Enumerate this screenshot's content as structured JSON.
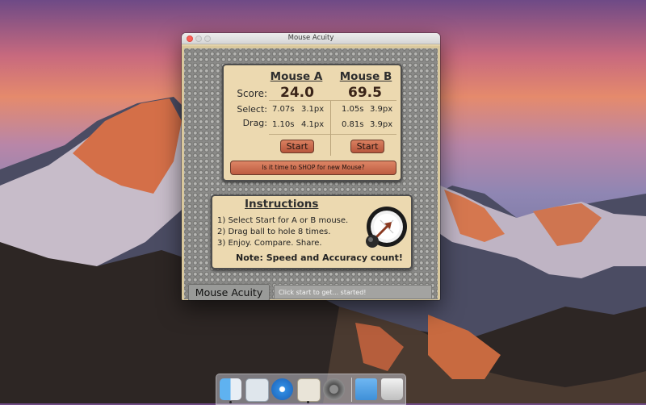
{
  "window": {
    "title": "Mouse Acuity"
  },
  "score_panel": {
    "mouse_a": {
      "title": "Mouse A",
      "score": "24.0",
      "select_time": "7.07s",
      "select_px": "3.1px",
      "drag_time": "1.10s",
      "drag_px": "4.1px",
      "start_label": "Start"
    },
    "mouse_b": {
      "title": "Mouse B",
      "score": "69.5",
      "select_time": "1.05s",
      "select_px": "3.9px",
      "drag_time": "0.81s",
      "drag_px": "3.9px",
      "start_label": "Start"
    },
    "labels": {
      "score": "Score:",
      "select": "Select:",
      "drag": "Drag:"
    },
    "shop_button": "Is it time to SHOP for new Mouse?"
  },
  "instructions": {
    "title": "Instructions",
    "steps": [
      "1) Select Start for A or B mouse.",
      "2) Drag ball to hole 8 times.",
      "3) Enjoy. Compare. Share."
    ],
    "note": "Note: Speed and Accuracy count!"
  },
  "footer": {
    "app_label": "Mouse Acuity",
    "status": "Click start to get... started!"
  },
  "colors": {
    "panel_bg": "#ecd9b0",
    "button": "#c9694c",
    "desktop_sky": "#e58a6c"
  },
  "dock": {
    "items": [
      "finder-icon",
      "preview-icon",
      "safari-icon",
      "app-store-icon",
      "system-preferences-icon",
      "applications-folder-icon",
      "trash-icon"
    ]
  }
}
